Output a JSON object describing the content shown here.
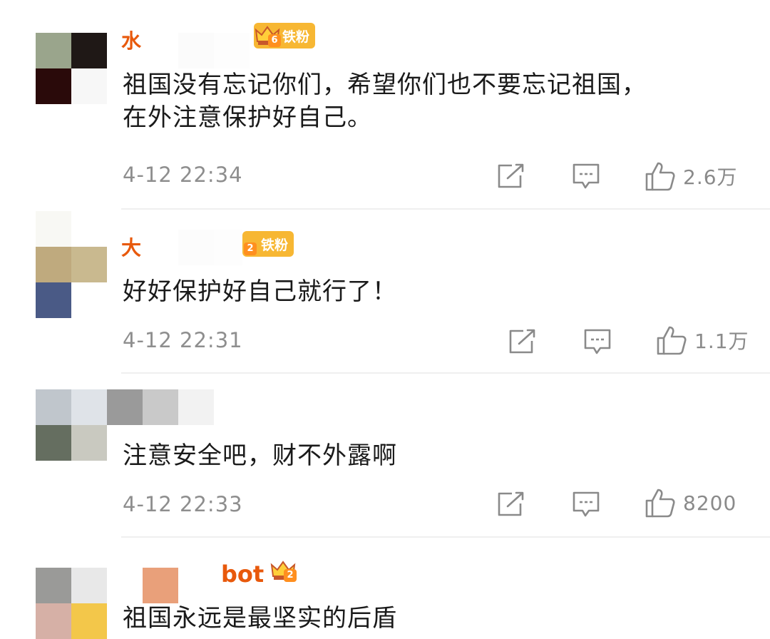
{
  "colors": {
    "accent_orange": "#e8590c",
    "badge_gold": "#f7b733",
    "meta_gray": "#8e8e8e",
    "divider": "#efefef"
  },
  "icons": {
    "share": "share-icon",
    "comment": "comment-icon",
    "like": "thumbs-up-icon",
    "badge": "crown-icon"
  },
  "comments": [
    {
      "username": "水",
      "badge": {
        "level": "6",
        "label": "铁粉"
      },
      "text_lines": [
        "祖国没有忘记你们，希望你们也不要忘记祖国，",
        "在外注意保护好自己。"
      ],
      "time": "4-12 22:34",
      "likes": "2.6万"
    },
    {
      "username": "大",
      "badge": {
        "level": "2",
        "label": "铁粉"
      },
      "text_lines": [
        "好好保护好自己就行了！"
      ],
      "time": "4-12 22:31",
      "likes": "1.1万"
    },
    {
      "username": "",
      "badge": null,
      "text_lines": [
        "注意安全吧，财不外露啊"
      ],
      "time": "4-12 22:33",
      "likes": "8200"
    },
    {
      "username": "bot",
      "badge": {
        "level": "2",
        "label": ""
      },
      "text_lines": [
        "祖国永远是最坚实的后盾"
      ],
      "time": "",
      "likes": ""
    }
  ]
}
